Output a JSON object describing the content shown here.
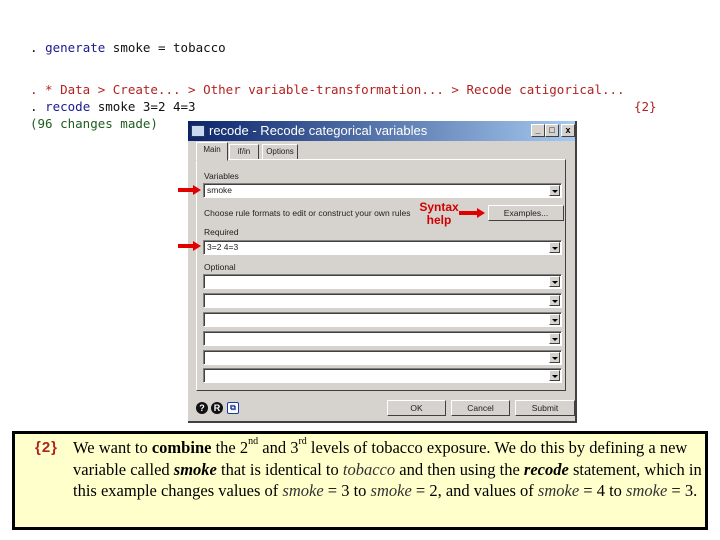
{
  "console": {
    "lines": [
      {
        "prompt": ". ",
        "cmd": "generate",
        "rest": " smoke = tobacco"
      },
      {
        "comment": ". * Data > Create... > Other variable-transformation... > Recode catigorical..."
      },
      {
        "prompt": ". ",
        "cmd": "recode",
        "rest": " smoke 3=2 4=3"
      },
      {
        "output": "(96 changes made)"
      }
    ],
    "ref_marker": "{2}"
  },
  "dialog": {
    "title": "recode - Recode categorical variables",
    "window_buttons": {
      "minimize": "_",
      "maximize": "□",
      "close": "x"
    },
    "tabs": [
      {
        "label": "Main",
        "active": true
      },
      {
        "label": "if/in",
        "active": false
      },
      {
        "label": "Options",
        "active": false
      }
    ],
    "variables_label": "Variables",
    "variables_value": "smoke",
    "rules_hint": "Choose rule formats to edit or construct your own rules",
    "examples_button": "Examples...",
    "required_label": "Required",
    "required_value": "3=2 4=3",
    "optional_label": "Optional",
    "optional_values": [
      "",
      "",
      "",
      "",
      "",
      ""
    ],
    "footer_icons": [
      "help-icon",
      "reset-icon",
      "copy-command-icon"
    ],
    "buttons": {
      "ok": "OK",
      "cancel": "Cancel",
      "submit": "Submit"
    }
  },
  "annotations": {
    "syntax_help_line1": "Syntax",
    "syntax_help_line2": "help",
    "arrow_color": "#e00000"
  },
  "note": {
    "marker": "{2}",
    "t1": "We want to ",
    "b1": "combine",
    "t2": " the 2",
    "sup1": "nd",
    "t3": " and 3",
    "sup2": "rd",
    "t4": " levels of tobacco exposure.  We do this by defining a new variable called ",
    "bi1": "smoke",
    "t5": " that is identical to ",
    "i1": "tobacco",
    "t6": " and then using the ",
    "bi2": "recode",
    "t7": " statement, which in this example changes values of ",
    "i2": "smoke",
    "t8": " = 3 to ",
    "i3": "smoke",
    "t9": " = 2, and values of ",
    "i4": "smoke",
    "t10": " = 4 to ",
    "i5": "smoke",
    "t11": " = 3."
  }
}
